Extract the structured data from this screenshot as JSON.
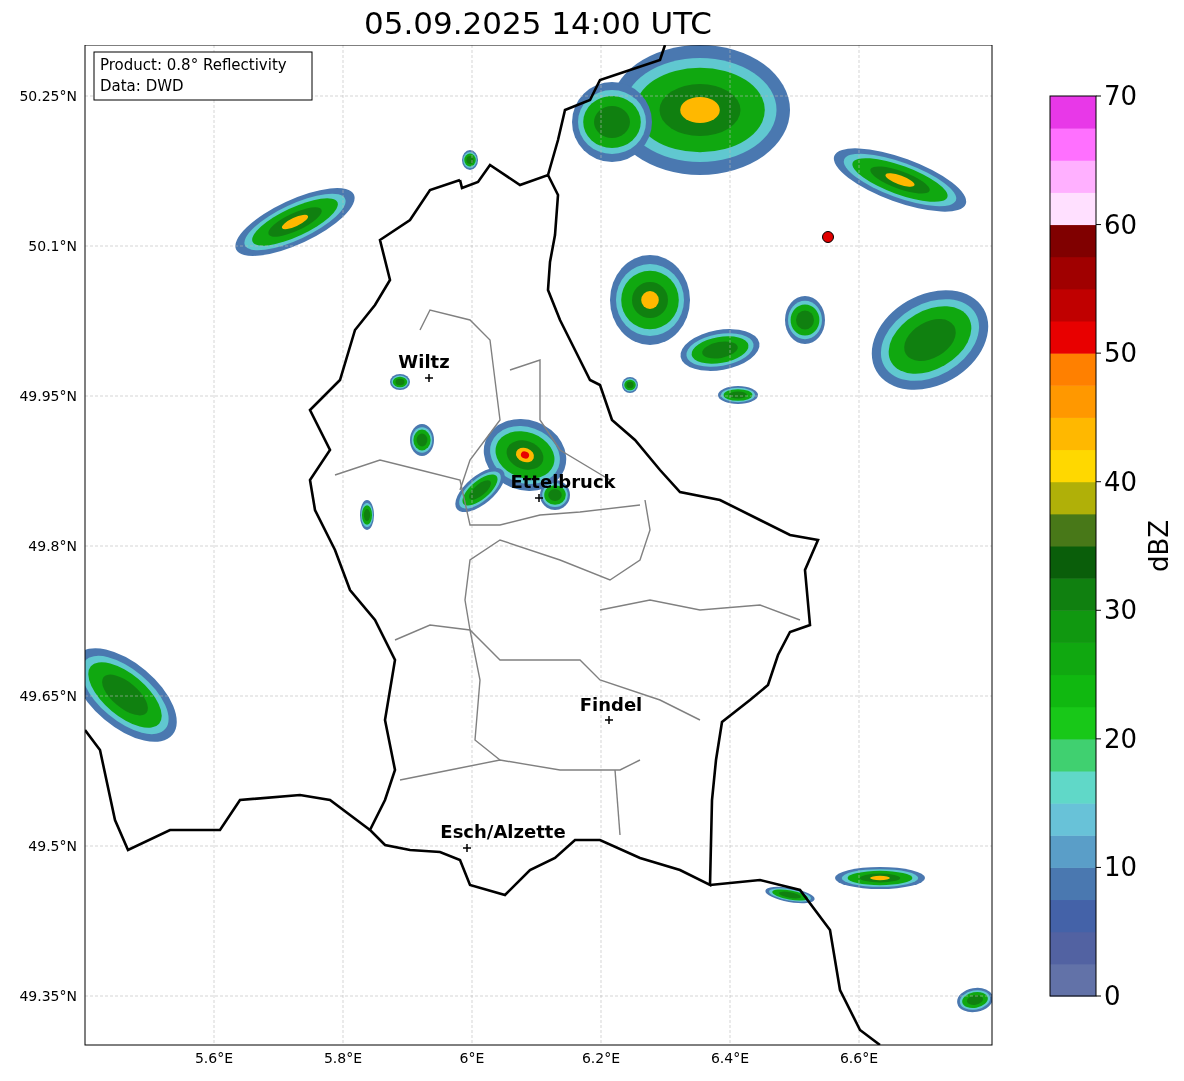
{
  "title": "05.09.2025 14:00 UTC",
  "info_box": [
    "Product: 0.8° Reflectivity",
    "Data: DWD"
  ],
  "y_ticks": [
    "50.25°N",
    "50.1°N",
    "49.95°N",
    "49.8°N",
    "49.65°N",
    "49.5°N",
    "49.35°N"
  ],
  "x_ticks": [
    "5.6°E",
    "5.8°E",
    "6°E",
    "6.2°E",
    "6.4°E",
    "6.6°E"
  ],
  "cities": [
    "Wiltz",
    "Ettelbruck",
    "Findel",
    "Esch/Alzette"
  ],
  "colorbar": {
    "label": "dBZ",
    "ticks": [
      "70",
      "60",
      "50",
      "40",
      "30",
      "20",
      "10",
      "0"
    ]
  }
}
